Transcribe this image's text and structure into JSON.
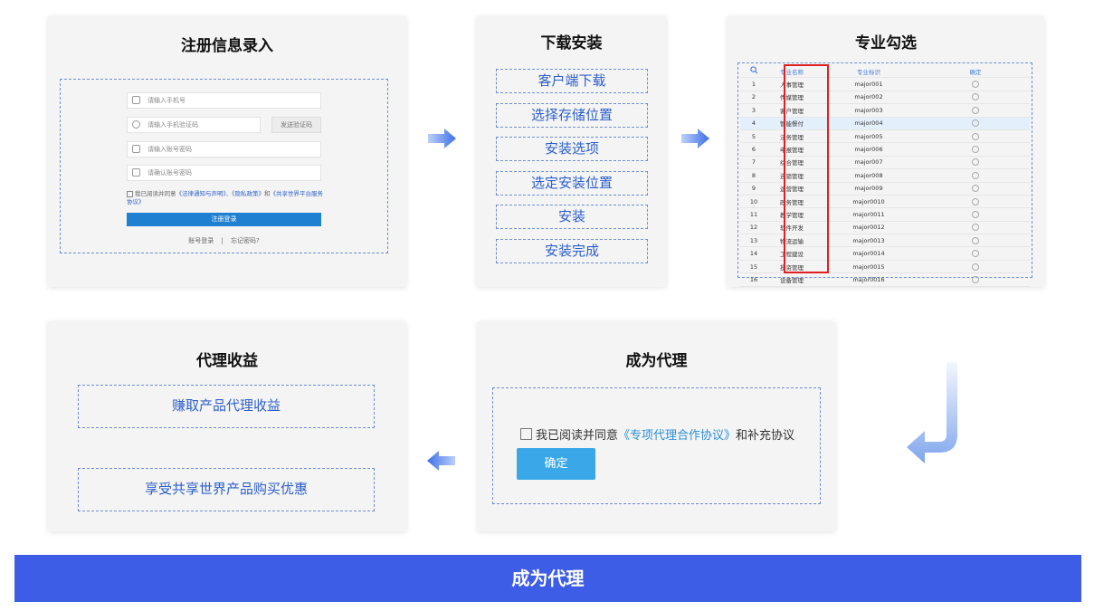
{
  "register": {
    "title": "注册信息录入",
    "phone_placeholder": "请输入手机号",
    "code_placeholder": "请输入手机验证码",
    "send_code": "发送验证码",
    "password_placeholder": "请输入账号密码",
    "confirm_placeholder": "请确认账号密码",
    "agree_prefix": "我已阅读并同意",
    "agree_link1": "《法律通知与声明》",
    "agree_sep": "、",
    "agree_link2": "《隐私政策》",
    "agree_and": "和",
    "agree_link3": "《共享世界平台服务协议》",
    "submit": "注册登录",
    "link_login": "账号登录",
    "link_sep": "|",
    "link_forgot": "忘记密码?"
  },
  "install": {
    "title": "下载安装",
    "steps": [
      "客户端下载",
      "选择存储位置",
      "安装选项",
      "选定安装位置",
      "安装",
      "安装完成"
    ]
  },
  "major": {
    "title": "专业勾选",
    "headers": [
      "专业名称",
      "专业标识",
      "确定"
    ],
    "rows": [
      {
        "no": "1",
        "name": "人事管理",
        "id": "major001"
      },
      {
        "no": "2",
        "name": "传媒管理",
        "id": "major002"
      },
      {
        "no": "3",
        "name": "客户管理",
        "id": "major003"
      },
      {
        "no": "4",
        "name": "智能餐付",
        "id": "major004"
      },
      {
        "no": "5",
        "name": "法务管理",
        "id": "major005"
      },
      {
        "no": "6",
        "name": "申报管理",
        "id": "major006"
      },
      {
        "no": "7",
        "name": "综合管理",
        "id": "major007"
      },
      {
        "no": "8",
        "name": "连锁管理",
        "id": "major008"
      },
      {
        "no": "9",
        "name": "运营管理",
        "id": "major009"
      },
      {
        "no": "10",
        "name": "政务管理",
        "id": "major0010"
      },
      {
        "no": "11",
        "name": "教学管理",
        "id": "major0011"
      },
      {
        "no": "12",
        "name": "软件开发",
        "id": "major0012"
      },
      {
        "no": "13",
        "name": "物流运输",
        "id": "major0013"
      },
      {
        "no": "14",
        "name": "工程建设",
        "id": "major0014"
      },
      {
        "no": "15",
        "name": "投资管理",
        "id": "major0015"
      },
      {
        "no": "16",
        "name": "设备管理",
        "id": "major0016"
      }
    ]
  },
  "agent": {
    "title": "成为代理",
    "agree_prefix": "我已阅读并同意",
    "agree_link": "《专项代理合作协议》",
    "agree_suffix": "和补充协议",
    "confirm": "确定"
  },
  "income": {
    "title": "代理收益",
    "benefits": [
      "赚取产品代理收益",
      "享受共享世界产品购买优惠"
    ]
  },
  "banner": {
    "text": "成为代理"
  },
  "colors": {
    "accent": "#3d5de6",
    "link": "#2c5fc9",
    "button": "#3aa8e8",
    "highlight_border": "#e02020"
  }
}
